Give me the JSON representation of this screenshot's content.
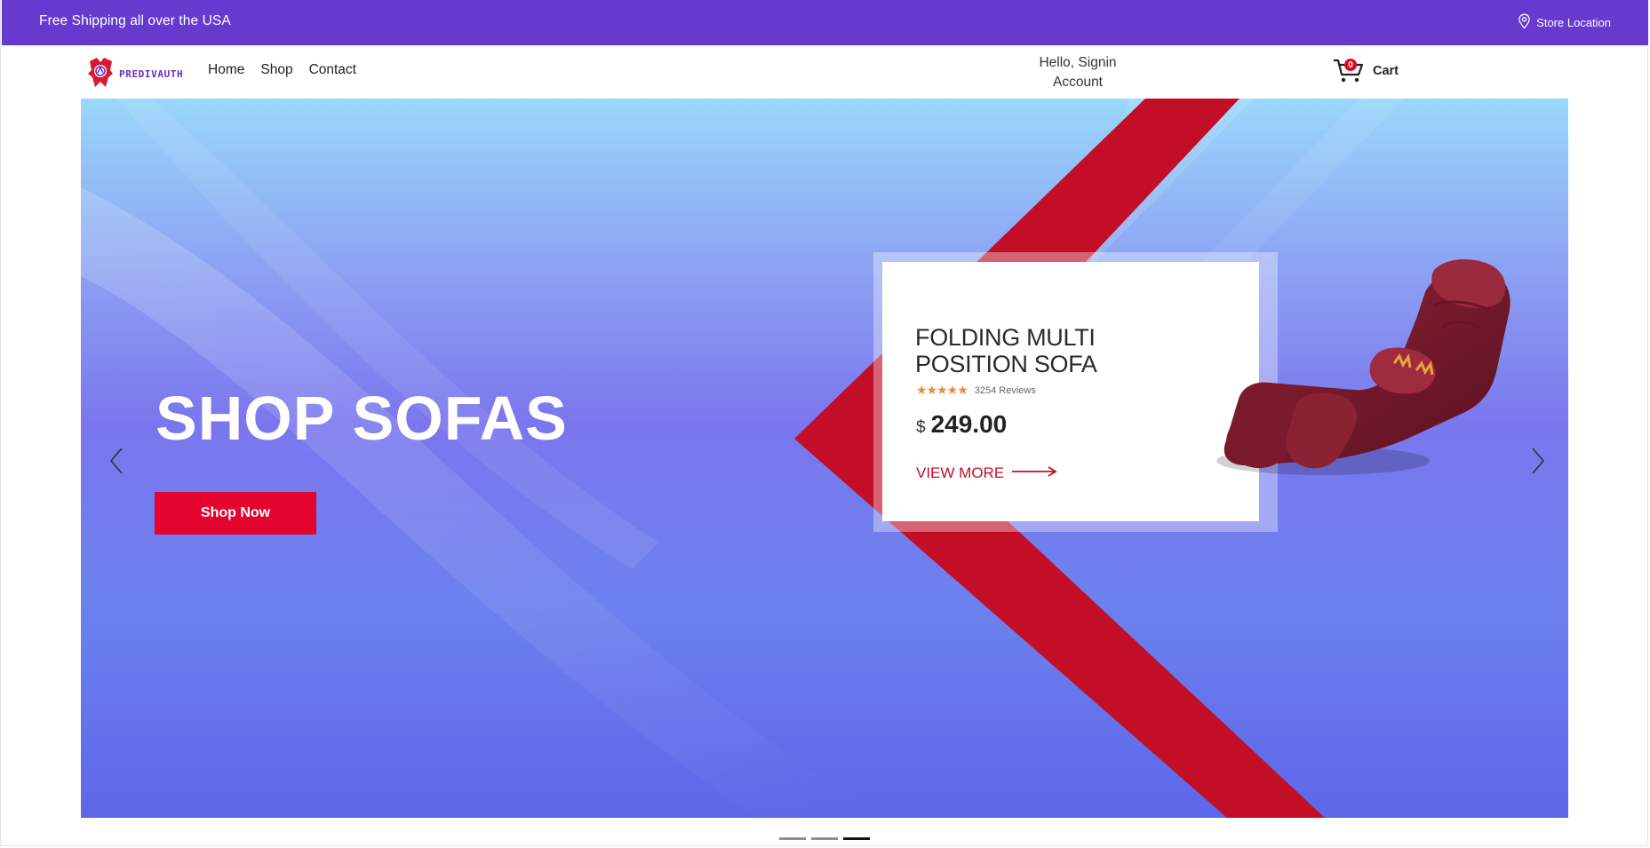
{
  "topbar": {
    "shipping_text": "Free Shipping all over the USA",
    "store_location": "Store Location",
    "background": "#6639cf"
  },
  "nav": {
    "brand": "PREDIVAUTH",
    "links": [
      "Home",
      "Shop",
      "Contact"
    ],
    "account_line1": "Hello, Signin",
    "account_line2": "Account",
    "cart_count": "0",
    "cart_label": "Cart"
  },
  "hero": {
    "title": "SHOP SOFAS",
    "button": "Shop Now",
    "accent": "#e3042f"
  },
  "product": {
    "name_line1": "FOLDING MULTI",
    "name_line2": "POSITION SOFA",
    "stars": "★★★★★",
    "rating": 5,
    "reviews": "3254 Reviews",
    "currency": "$",
    "price": "249.00",
    "view_more": "VIEW MORE"
  },
  "carousel": {
    "slides": 3,
    "active_index": 3
  },
  "icons": {
    "location": "location-pin-icon",
    "cart": "cart-icon",
    "prev": "chevron-left-icon",
    "next": "chevron-right-icon",
    "arrow": "arrow-right-icon"
  }
}
